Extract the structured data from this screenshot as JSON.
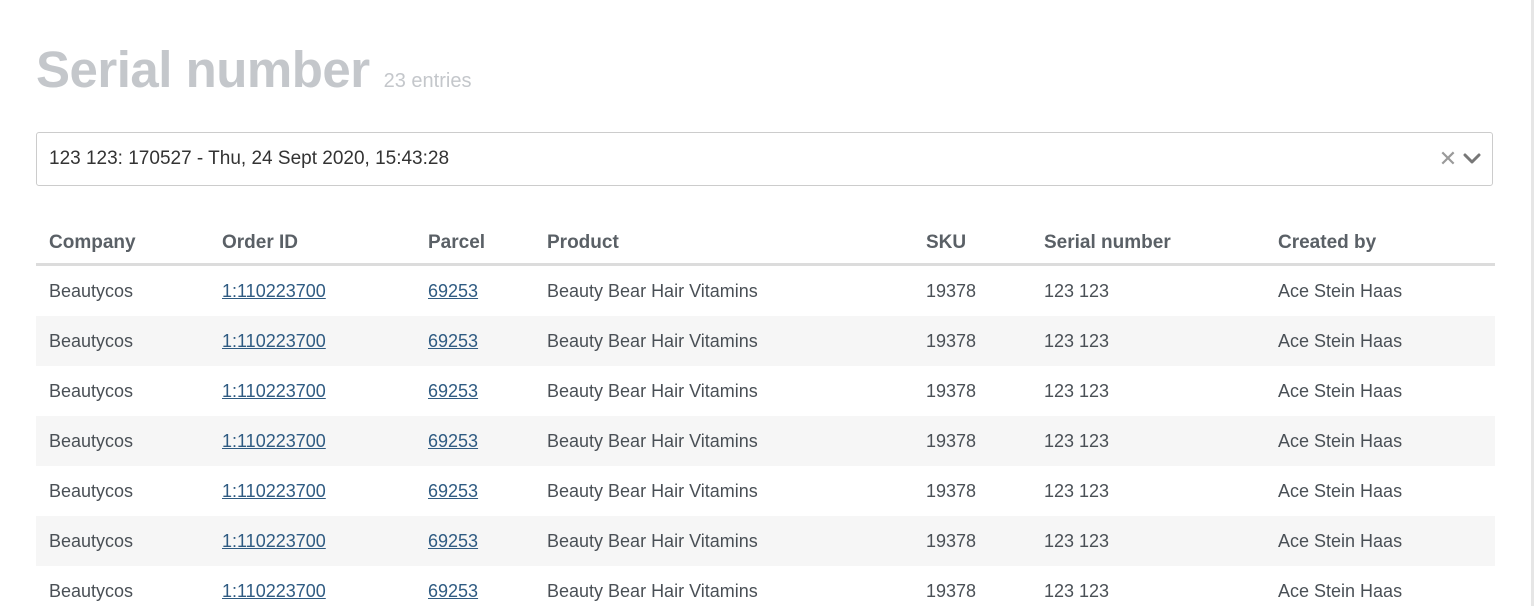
{
  "header": {
    "title": "Serial number",
    "count": "23 entries"
  },
  "filter": {
    "value": "123 123: 170527 - Thu, 24 Sept 2020, 15:43:28",
    "clear_glyph": "✕",
    "clear_icon": "close-icon",
    "dropdown_icon": "chevron-down-icon"
  },
  "table": {
    "columns": [
      "Company",
      "Order ID",
      "Parcel",
      "Product",
      "SKU",
      "Serial number",
      "Created by"
    ],
    "rows": [
      {
        "company": "Beautycos",
        "order_id": "1:110223700",
        "parcel": "69253",
        "product": "Beauty Bear Hair Vitamins",
        "sku": "19378",
        "serial": "123 123",
        "created_by": "Ace Stein Haas"
      },
      {
        "company": "Beautycos",
        "order_id": "1:110223700",
        "parcel": "69253",
        "product": "Beauty Bear Hair Vitamins",
        "sku": "19378",
        "serial": "123 123",
        "created_by": "Ace Stein Haas"
      },
      {
        "company": "Beautycos",
        "order_id": "1:110223700",
        "parcel": "69253",
        "product": "Beauty Bear Hair Vitamins",
        "sku": "19378",
        "serial": "123 123",
        "created_by": "Ace Stein Haas"
      },
      {
        "company": "Beautycos",
        "order_id": "1:110223700",
        "parcel": "69253",
        "product": "Beauty Bear Hair Vitamins",
        "sku": "19378",
        "serial": "123 123",
        "created_by": "Ace Stein Haas"
      },
      {
        "company": "Beautycos",
        "order_id": "1:110223700",
        "parcel": "69253",
        "product": "Beauty Bear Hair Vitamins",
        "sku": "19378",
        "serial": "123 123",
        "created_by": "Ace Stein Haas"
      },
      {
        "company": "Beautycos",
        "order_id": "1:110223700",
        "parcel": "69253",
        "product": "Beauty Bear Hair Vitamins",
        "sku": "19378",
        "serial": "123 123",
        "created_by": "Ace Stein Haas"
      },
      {
        "company": "Beautycos",
        "order_id": "1:110223700",
        "parcel": "69253",
        "product": "Beauty Bear Hair Vitamins",
        "sku": "19378",
        "serial": "123 123",
        "created_by": "Ace Stein Haas"
      }
    ]
  }
}
